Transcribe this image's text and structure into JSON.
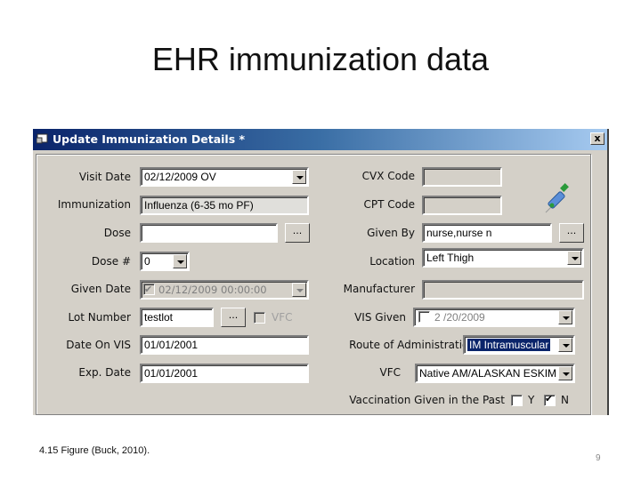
{
  "slide": {
    "title": "EHR immunization data",
    "caption": "4.15 Figure (Buck, 2010).",
    "page_number": "9"
  },
  "window": {
    "title": "Update Immunization Details *",
    "close_label": "x",
    "icons": {
      "window": "form-icon",
      "decoration": "syringe-icon"
    }
  },
  "form": {
    "visit_date": {
      "label": "Visit Date",
      "value": "02/12/2009 OV"
    },
    "immunization": {
      "label": "Immunization",
      "value": "Influenza (6-35 mo PF)"
    },
    "dose": {
      "label": "Dose",
      "value": "",
      "button": "..."
    },
    "dose_number": {
      "label": "Dose #",
      "value": "0"
    },
    "given_date": {
      "label": "Given Date",
      "value": "02/12/2009 00:00:00",
      "checked": true,
      "disabled": true
    },
    "lot_number": {
      "label": "Lot Number",
      "value": "testlot",
      "button": "...",
      "vfc_label": "VFC",
      "vfc_checked": false
    },
    "date_on_vis": {
      "label": "Date On VIS",
      "value": "01/01/2001"
    },
    "exp_date": {
      "label": "Exp. Date",
      "value": "01/01/2001"
    },
    "cvx_code": {
      "label": "CVX Code",
      "value": ""
    },
    "cpt_code": {
      "label": "CPT Code",
      "value": ""
    },
    "given_by": {
      "label": "Given By",
      "value": "nurse,nurse n",
      "button": "..."
    },
    "location": {
      "label": "Location",
      "value": "Left Thigh"
    },
    "manufacturer": {
      "label": "Manufacturer",
      "value": ""
    },
    "vis_given": {
      "label": "VIS Given",
      "value": "2 /20/2009",
      "checked": false
    },
    "route": {
      "label": "Route of Administration",
      "value": "IM Intramuscular"
    },
    "vfc": {
      "label": "VFC",
      "value": "Native AM/ALASKAN ESKIM"
    },
    "vaccination_past": {
      "label": "Vaccination Given in the Past",
      "yes_label": "Y",
      "yes_checked": false,
      "no_label": "N",
      "no_checked": true
    }
  }
}
